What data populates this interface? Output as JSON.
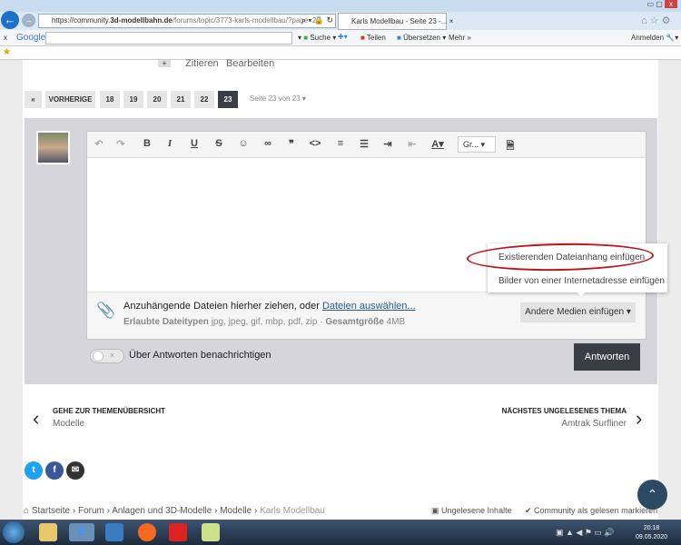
{
  "browser": {
    "url_prefix": "https://community.",
    "url_domain": "3d-modellbahn.de",
    "url_path": "/forums/topic/3773-karls-modellbau/?page=23",
    "tab_title": "Karls Modellbau - Seite 23 -...",
    "google_label": "Google",
    "search_label": "Suche",
    "share_label": "Teilen",
    "translate_label": "Übersetzen",
    "more_label": "Mehr »",
    "signin_label": "Anmelden"
  },
  "post_actions": {
    "quote": "Zitieren",
    "edit": "Bearbeiten"
  },
  "pagination": {
    "prev": "VORHERIGE",
    "pages": [
      "18",
      "19",
      "20",
      "21",
      "22",
      "23"
    ],
    "current": "23",
    "page_info": "Seite 23 von 23"
  },
  "editor": {
    "font_select": "Gr...",
    "attach_text": "Anzuhängende Dateien hierher ziehen, oder ",
    "attach_link": "Dateien auswählen...",
    "allowed_label": "Erlaubte Dateitypen",
    "allowed_types": "jpg, jpeg, gif, mbp, pdf, zip",
    "sep": "·",
    "size_label": "Gesamtgröße",
    "size_value": "4MB",
    "other_media": "Andere Medien einfügen ▾",
    "menu": [
      "Existierenden Dateianhang einfügen",
      "Bilder von einer Internetadresse einfügen"
    ],
    "notify_label": "Über Antworten benachrichtigen",
    "notify_on": false,
    "submit": "Antworten"
  },
  "nav": {
    "prev_heading": "GEHE ZUR THEMENÜBERSICHT",
    "prev_sub": "Modelle",
    "next_heading": "NÄCHSTES UNGELESENES THEMA",
    "next_sub": "Amtrak Surfliner"
  },
  "breadcrumb": [
    "Startseite",
    "Forum",
    "Anlagen und 3D-Modelle",
    "Modelle",
    "Karls Modellbau"
  ],
  "footer_links": {
    "unread": "Ungelesene Inhalte",
    "mark_read": "Community als gelesen markieren"
  },
  "taskbar": {
    "time": "20:18",
    "date": "09.05.2020"
  },
  "colors": {
    "accent": "#2c4a63",
    "dark_button": "#3a3d44",
    "highlight_ellipse": "#c0141c",
    "twitter": "#1da1f2",
    "facebook": "#3b5998"
  }
}
